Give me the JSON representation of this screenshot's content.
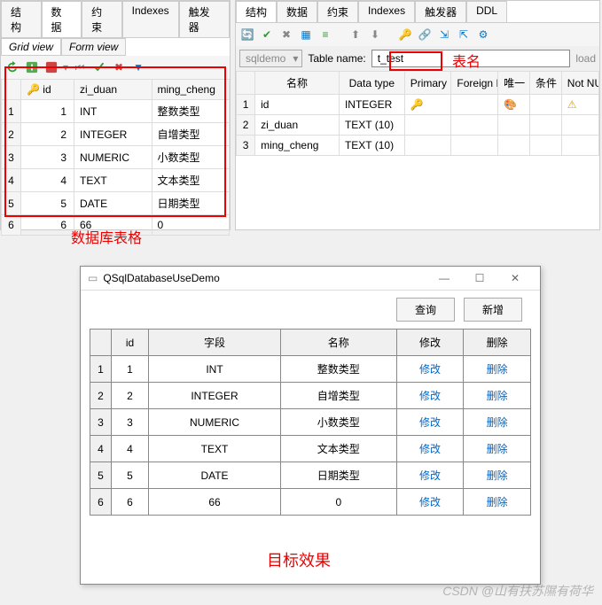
{
  "left": {
    "tabs": [
      "结构",
      "数据",
      "约束",
      "Indexes",
      "触发器"
    ],
    "activeTab": 1,
    "subtabs": [
      "Grid view",
      "Form view"
    ],
    "activeSub": 0,
    "columns": [
      "id",
      "zi_duan",
      "ming_cheng"
    ],
    "rows": [
      {
        "n": "1",
        "id": "1",
        "zi_duan": "INT",
        "ming_cheng": "整数类型"
      },
      {
        "n": "2",
        "id": "2",
        "zi_duan": "INTEGER",
        "ming_cheng": "自增类型"
      },
      {
        "n": "3",
        "id": "3",
        "zi_duan": "NUMERIC",
        "ming_cheng": "小数类型"
      },
      {
        "n": "4",
        "id": "4",
        "zi_duan": "TEXT",
        "ming_cheng": "文本类型"
      },
      {
        "n": "5",
        "id": "5",
        "zi_duan": "DATE",
        "ming_cheng": "日期类型"
      },
      {
        "n": "6",
        "id": "6",
        "zi_duan": "66",
        "ming_cheng": "0"
      }
    ],
    "label": "数据库表格"
  },
  "right": {
    "tabs": [
      "结构",
      "数据",
      "约束",
      "Indexes",
      "触发器",
      "DDL"
    ],
    "activeTab": 0,
    "dbSelect": "sqldemo",
    "tableNameLabel": "Table name:",
    "tableName": "t_test",
    "tableNameAnno": "表名",
    "loadText": "load",
    "headers": [
      "名称",
      "Data type",
      "Primary Key",
      "Foreign Key",
      "唯一",
      "条件",
      "Not NULL"
    ],
    "rows": [
      {
        "n": "1",
        "name": "id",
        "dtype": "INTEGER",
        "pk": true,
        "pal": true,
        "warn": true
      },
      {
        "n": "2",
        "name": "zi_duan",
        "dtype": "TEXT (10)"
      },
      {
        "n": "3",
        "name": "ming_cheng",
        "dtype": "TEXT (10)"
      }
    ]
  },
  "demo": {
    "title": "QSqlDatabaseUseDemo",
    "btnQuery": "查询",
    "btnNew": "新增",
    "headers": [
      "id",
      "字段",
      "名称",
      "修改",
      "删除"
    ],
    "modifyText": "修改",
    "deleteText": "删除",
    "rows": [
      {
        "n": "1",
        "id": "1",
        "field": "INT",
        "name": "整数类型"
      },
      {
        "n": "2",
        "id": "2",
        "field": "INTEGER",
        "name": "自增类型"
      },
      {
        "n": "3",
        "id": "3",
        "field": "NUMERIC",
        "name": "小数类型"
      },
      {
        "n": "4",
        "id": "4",
        "field": "TEXT",
        "name": "文本类型"
      },
      {
        "n": "5",
        "id": "5",
        "field": "DATE",
        "name": "日期类型"
      },
      {
        "n": "6",
        "id": "6",
        "field": "66",
        "name": "0"
      }
    ],
    "label": "目标效果"
  },
  "watermark": "CSDN @山有扶苏隰有荷华"
}
